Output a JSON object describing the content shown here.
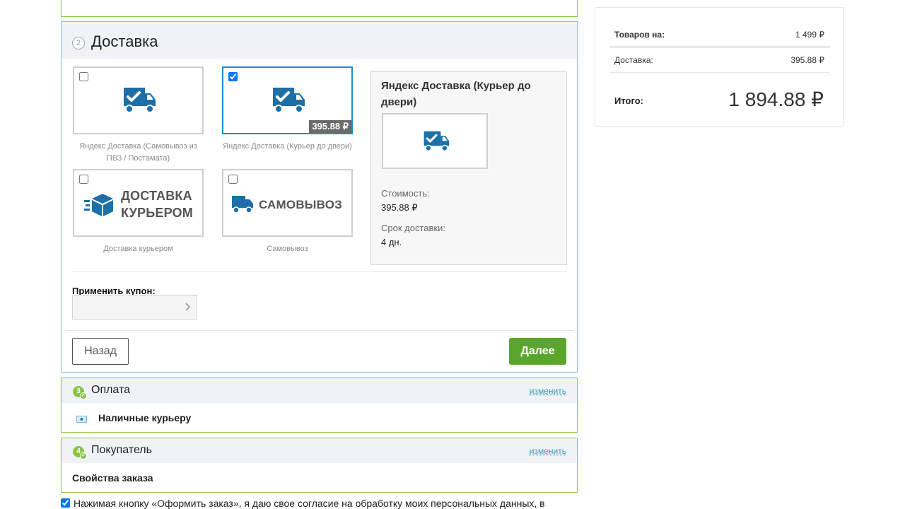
{
  "delivery": {
    "step_number": "2",
    "title": "Доставка",
    "options": [
      {
        "label": "Яндекс Доставка (Самовывоз из ПВЗ / Постамата)",
        "checked": false,
        "logo": "truck-check-icon"
      },
      {
        "label": "Яндекс Доставка (Курьер до двери)",
        "checked": true,
        "price_badge": "395.88 ₽",
        "logo": "truck-check-icon"
      },
      {
        "label": "Доставка курьером",
        "checked": false,
        "logo_text_1": "ДОСТАВКА",
        "logo_text_2": "КУРЬЕРОМ"
      },
      {
        "label": "Самовывоз",
        "checked": false,
        "logo_text": "САМОВЫВОЗ"
      }
    ],
    "info": {
      "title": "Яндекс Доставка (Курьер до двери)",
      "cost_label": "Стоимость:",
      "cost_value": "395.88 ₽",
      "term_label": "Срок доставки:",
      "term_value": "4 дн."
    },
    "coupon_label": "Применить купон:",
    "coupon_value": "",
    "back_label": "Назад",
    "next_label": "Далее"
  },
  "payment": {
    "step_number": "3",
    "title": "Оплата",
    "change_label": "изменить",
    "method": "Наличные курьеру"
  },
  "buyer": {
    "step_number": "4",
    "title": "Покупатель",
    "change_label": "изменить",
    "props": "Свойства заказа"
  },
  "consent_text": "Нажимая кнопку «Оформить заказ», я даю свое согласие на обработку моих персональных данных, в",
  "summary": {
    "goods_label": "Товаров на:",
    "goods_value": "1 499 ₽",
    "delivery_label": "Доставка:",
    "delivery_value": "395.88 ₽",
    "total_label": "Итого:",
    "total_value": "1 894.88 ₽"
  },
  "colors": {
    "accent_blue": "#1e8fc6",
    "brand_green": "#5ca52c",
    "icon_blue": "#1d6fa8"
  }
}
